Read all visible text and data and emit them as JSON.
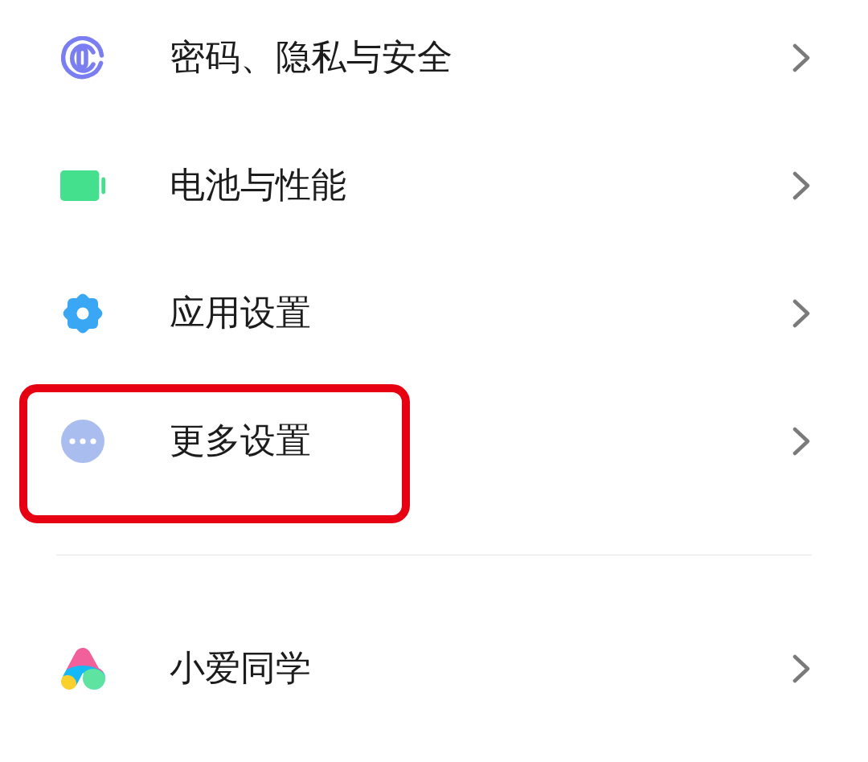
{
  "sections": [
    {
      "items": [
        {
          "label": "密码、隐私与安全",
          "highlighted": false
        },
        {
          "label": "电池与性能",
          "highlighted": false
        },
        {
          "label": "应用设置",
          "highlighted": false
        },
        {
          "label": "更多设置",
          "highlighted": true
        }
      ]
    },
    {
      "items": [
        {
          "label": "小爱同学",
          "highlighted": false
        }
      ]
    }
  ]
}
